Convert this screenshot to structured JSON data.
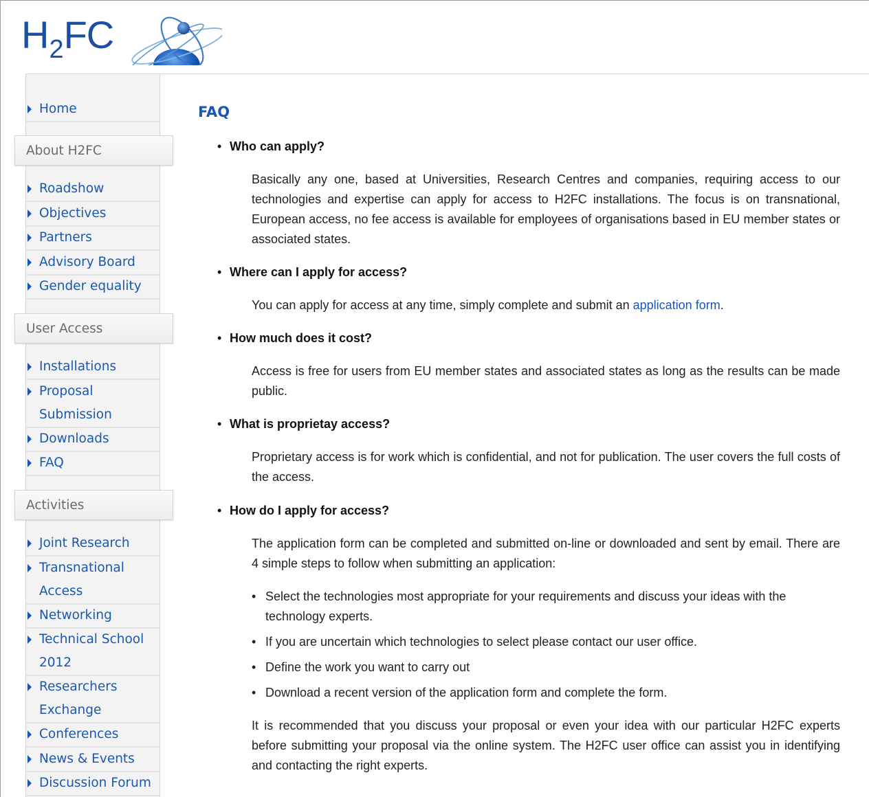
{
  "logo": {
    "text_main": "H",
    "text_sub": "2",
    "text_end": "FC"
  },
  "sidebar": {
    "home": "Home",
    "sections": [
      {
        "title": "About H2FC",
        "items": [
          {
            "label": "Roadshow"
          },
          {
            "label": "Objectives"
          },
          {
            "label": "Partners"
          },
          {
            "label": "Advisory Board"
          },
          {
            "label": "Gender equality"
          }
        ]
      },
      {
        "title": "User Access",
        "items": [
          {
            "label": "Installations"
          },
          {
            "label": "Proposal",
            "label2": "Submission"
          },
          {
            "label": "Downloads"
          },
          {
            "label": "FAQ"
          }
        ]
      },
      {
        "title": "Activities",
        "items": [
          {
            "label": "Joint Research"
          },
          {
            "label": "Transnational",
            "label2": "Access"
          },
          {
            "label": "Networking"
          },
          {
            "label": "Technical School",
            "label2": "2012"
          },
          {
            "label": "Researchers",
            "label2": "Exchange"
          },
          {
            "label": "Conferences"
          },
          {
            "label": "News & Events"
          },
          {
            "label": "Discussion Forum"
          }
        ]
      }
    ]
  },
  "main": {
    "title": "FAQ",
    "bullet": "•",
    "faqs": [
      {
        "question": "Who can apply?",
        "answer": "Basically any one, based at Universities, Research Centres and companies, requiring access to our technologies and expertise can apply for access to H2FC installations. The focus is on transnational, European access, no fee access is available for employees of organisations based in EU member states or associated states."
      },
      {
        "question": "Where can I apply for access?",
        "answer_prefix": "You can apply for access at any time, simply complete and submit an ",
        "answer_link": "application form",
        "answer_suffix": "."
      },
      {
        "question": "How much does it cost?",
        "answer": "Access is free for users from EU member states and associated states as long as the results can be made public."
      },
      {
        "question": "What is proprietay access?",
        "answer": "Proprietary access is for work which is confidential, and not for publication. The user covers the full costs of the access."
      },
      {
        "question": "How do I apply for access?",
        "answer": "The application form can be completed and submitted on-line or downloaded and sent by email. There are 4 simple steps to follow when submitting an application:",
        "steps": [
          "Select the technologies most appropriate for your requirements and discuss your ideas with the technology experts.",
          "If you are uncertain which technologies to select please contact our user office.",
          "Define the work you want to carry out",
          "Download a recent version of the application form and complete the form."
        ],
        "closing": "It is recommended that you discuss your proposal or even your idea with our particular H2FC experts before submitting your proposal via the online system. The H2FC user office can assist you in identifying and contacting the right experts."
      }
    ]
  },
  "colors": {
    "link": "#1a58b0",
    "logo": "#1d4fa0",
    "sidebar_bg": "#f3f3f3",
    "section_text": "#6a6a6a"
  }
}
